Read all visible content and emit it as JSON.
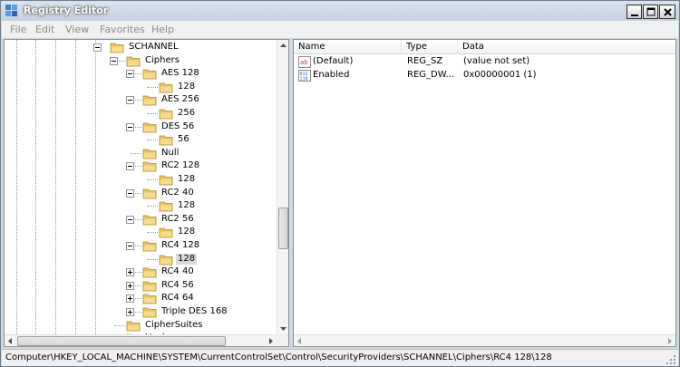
{
  "window": {
    "title": "Registry Editor"
  },
  "menu": [
    "File",
    "Edit",
    "View",
    "Favorites",
    "Help"
  ],
  "tree": {
    "nodes": [
      {
        "label": "SCHANNEL",
        "expander": "minus",
        "selected": false
      },
      {
        "label": "Ciphers",
        "expander": "minus",
        "selected": false
      },
      {
        "label": "AES 128",
        "expander": "minus",
        "selected": false
      },
      {
        "label": "128",
        "expander": "none",
        "selected": false
      },
      {
        "label": "AES 256",
        "expander": "minus",
        "selected": false
      },
      {
        "label": "256",
        "expander": "none",
        "selected": false
      },
      {
        "label": "DES 56",
        "expander": "minus",
        "selected": false
      },
      {
        "label": "56",
        "expander": "none",
        "selected": false
      },
      {
        "label": "Null",
        "expander": "none",
        "selected": false
      },
      {
        "label": "RC2 128",
        "expander": "minus",
        "selected": false
      },
      {
        "label": "128",
        "expander": "none",
        "selected": false
      },
      {
        "label": "RC2 40",
        "expander": "minus",
        "selected": false
      },
      {
        "label": "128",
        "expander": "none",
        "selected": false
      },
      {
        "label": "RC2 56",
        "expander": "minus",
        "selected": false
      },
      {
        "label": "128",
        "expander": "none",
        "selected": false
      },
      {
        "label": "RC4 128",
        "expander": "minus",
        "selected": false
      },
      {
        "label": "128",
        "expander": "none",
        "selected": true
      },
      {
        "label": "RC4 40",
        "expander": "plus",
        "selected": false
      },
      {
        "label": "RC4 56",
        "expander": "plus",
        "selected": false
      },
      {
        "label": "RC4 64",
        "expander": "plus",
        "selected": false
      },
      {
        "label": "Triple DES 168",
        "expander": "plus",
        "selected": false
      },
      {
        "label": "CipherSuites",
        "expander": "none",
        "selected": false
      },
      {
        "label": "Hashes",
        "expander": "none",
        "selected": false
      }
    ]
  },
  "values": {
    "columns": [
      "Name",
      "Type",
      "Data"
    ],
    "rows": [
      {
        "icon": "string-value-icon",
        "name": "(Default)",
        "type": "REG_SZ",
        "data": "(value not set)"
      },
      {
        "icon": "binary-value-icon",
        "name": "Enabled",
        "type": "REG_DW...",
        "data": "0x00000001 (1)"
      }
    ]
  },
  "status": {
    "path": "Computer\\HKEY_LOCAL_MACHINE\\SYSTEM\\CurrentControlSet\\Control\\SecurityProviders\\SCHANNEL\\Ciphers\\RC4 128\\128"
  },
  "colors": {
    "folder": "#e8c35c",
    "selection": "#d9d9d9",
    "menu_text": "#8b8b8b"
  }
}
